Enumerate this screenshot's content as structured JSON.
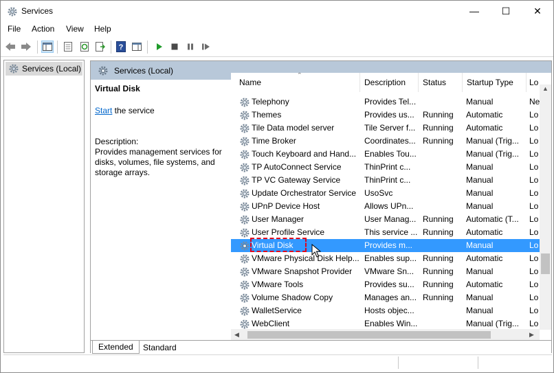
{
  "window": {
    "title": "Services",
    "controls": {
      "minimize": "—",
      "maximize": "☐",
      "close": "✕"
    }
  },
  "menu": [
    "File",
    "Action",
    "View",
    "Help"
  ],
  "toolbar": {
    "icons": [
      "back-icon",
      "forward-icon",
      "show-hide-console-tree-icon",
      "properties-icon",
      "refresh-icon",
      "export-list-icon",
      "help-icon",
      "show-action-pane-icon",
      "start-service-icon",
      "stop-service-icon",
      "pause-service-icon",
      "restart-service-icon"
    ]
  },
  "tree": {
    "item": "Services (Local)"
  },
  "pane": {
    "header": "Services (Local)",
    "detail": {
      "name": "Virtual Disk",
      "start_link": "Start",
      "start_suffix": " the service",
      "description_label": "Description:",
      "description": "Provides management services for disks, volumes, file systems, and storage arrays."
    },
    "columns": [
      "Name",
      "Description",
      "Status",
      "Startup Type",
      "Lo"
    ],
    "rows": [
      {
        "name": "Telephony",
        "description": "Provides Tel...",
        "status": "",
        "startup": "Manual",
        "log": "Ne"
      },
      {
        "name": "Themes",
        "description": "Provides us...",
        "status": "Running",
        "startup": "Automatic",
        "log": "Lo"
      },
      {
        "name": "Tile Data model server",
        "description": "Tile Server f...",
        "status": "Running",
        "startup": "Automatic",
        "log": "Lo"
      },
      {
        "name": "Time Broker",
        "description": "Coordinates...",
        "status": "Running",
        "startup": "Manual (Trig...",
        "log": "Lo"
      },
      {
        "name": "Touch Keyboard and Hand...",
        "description": "Enables Tou...",
        "status": "",
        "startup": "Manual (Trig...",
        "log": "Lo"
      },
      {
        "name": "TP AutoConnect Service",
        "description": "ThinPrint c...",
        "status": "",
        "startup": "Manual",
        "log": "Lo"
      },
      {
        "name": "TP VC Gateway Service",
        "description": "ThinPrint c...",
        "status": "",
        "startup": "Manual",
        "log": "Lo"
      },
      {
        "name": "Update Orchestrator Service",
        "description": "UsoSvc",
        "status": "",
        "startup": "Manual",
        "log": "Lo"
      },
      {
        "name": "UPnP Device Host",
        "description": "Allows UPn...",
        "status": "",
        "startup": "Manual",
        "log": "Lo"
      },
      {
        "name": "User Manager",
        "description": "User Manag...",
        "status": "Running",
        "startup": "Automatic (T...",
        "log": "Lo"
      },
      {
        "name": "User Profile Service",
        "description": "This service ...",
        "status": "Running",
        "startup": "Automatic",
        "log": "Lo"
      },
      {
        "name": "Virtual Disk",
        "description": "Provides m...",
        "status": "",
        "startup": "Manual",
        "log": "Lo",
        "selected": true
      },
      {
        "name": "VMware Physical Disk Help...",
        "description": "Enables sup...",
        "status": "Running",
        "startup": "Automatic",
        "log": "Lo"
      },
      {
        "name": "VMware Snapshot Provider",
        "description": "VMware Sn...",
        "status": "Running",
        "startup": "Manual",
        "log": "Lo"
      },
      {
        "name": "VMware Tools",
        "description": "Provides su...",
        "status": "Running",
        "startup": "Automatic",
        "log": "Lo"
      },
      {
        "name": "Volume Shadow Copy",
        "description": "Manages an...",
        "status": "Running",
        "startup": "Manual",
        "log": "Lo"
      },
      {
        "name": "WalletService",
        "description": "Hosts objec...",
        "status": "",
        "startup": "Manual",
        "log": "Lo"
      },
      {
        "name": "WebClient",
        "description": "Enables Win...",
        "status": "",
        "startup": "Manual (Trig...",
        "log": "Lo"
      }
    ],
    "tabs": [
      "Extended",
      "Standard"
    ]
  },
  "colors": {
    "selection": "#3399ff",
    "header_band": "#b8c8d9",
    "highlight_box": "#e0001b",
    "link": "#0066cc"
  }
}
